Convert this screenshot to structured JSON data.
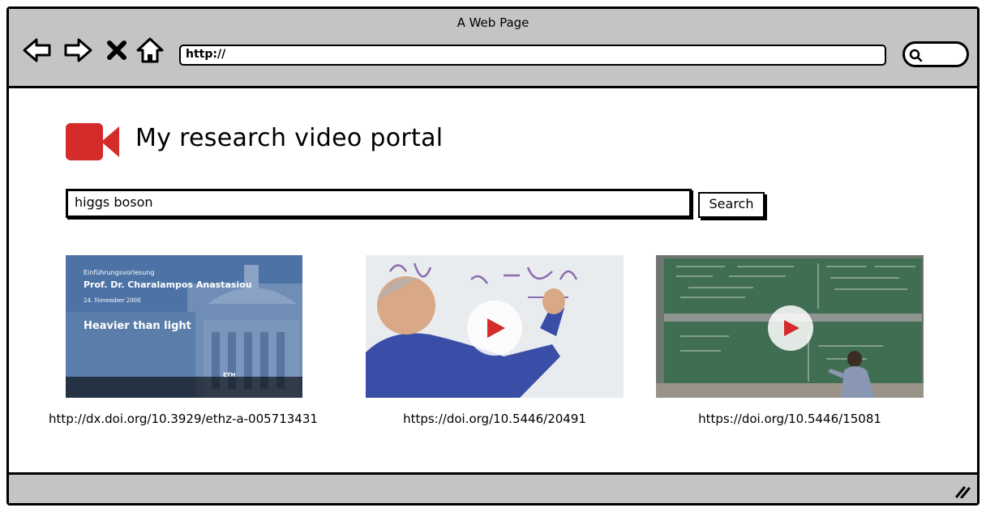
{
  "browser": {
    "window_title": "A Web Page",
    "address": "http://",
    "nav_icons": [
      "back-arrow-icon",
      "forward-arrow-icon",
      "stop-icon",
      "home-icon"
    ],
    "search_icon": "magnifier-icon"
  },
  "portal": {
    "logo_icon": "video-camera-icon",
    "logo_color": "#d42b2b",
    "title": "My research video portal"
  },
  "search": {
    "query": "higgs boson",
    "button_label": "Search"
  },
  "results": [
    {
      "doi": "http://dx.doi.org/10.3929/ethz-a-005713431",
      "thumb": {
        "line1": "Einführungsvorlesung",
        "line2": "Prof. Dr. Charalampos Anastasiou",
        "line3": "24. November 2008",
        "line4": "Heavier than light",
        "badge": "ETH"
      }
    },
    {
      "doi": "https://doi.org/10.5446/20491",
      "thumb": {
        "play_icon": "play-icon"
      }
    },
    {
      "doi": "https://doi.org/10.5446/15081",
      "thumb": {
        "play_icon": "play-icon"
      }
    }
  ]
}
